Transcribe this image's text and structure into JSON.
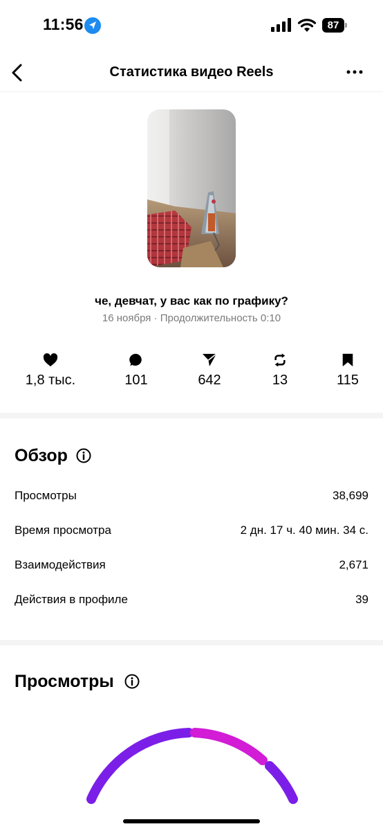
{
  "status_bar": {
    "time": "11:56",
    "battery": "87"
  },
  "header": {
    "title": "Статистика видео Reels"
  },
  "video": {
    "caption": "че, девчат, у вас как по графику?",
    "meta": "16 ноября · Продолжительность 0:10"
  },
  "metrics": [
    {
      "icon": "heart-icon",
      "value": "1,8 тыс."
    },
    {
      "icon": "comment-icon",
      "value": "101"
    },
    {
      "icon": "share-icon",
      "value": "642"
    },
    {
      "icon": "repost-icon",
      "value": "13"
    },
    {
      "icon": "bookmark-icon",
      "value": "115"
    }
  ],
  "overview": {
    "title": "Обзор",
    "rows": [
      {
        "label": "Просмотры",
        "value": "38,699"
      },
      {
        "label": "Время просмотра",
        "value": "2 дн. 17 ч. 40 мин. 34 с."
      },
      {
        "label": "Взаимодействия",
        "value": "2,671"
      },
      {
        "label": "Действия в профиле",
        "value": "39"
      }
    ]
  },
  "views_section": {
    "title": "Просмотры"
  },
  "colors": {
    "gauge_primary": "#7b1fe8",
    "gauge_secondary": "#d21cd6",
    "accent_blue": "#1d8bf0"
  }
}
